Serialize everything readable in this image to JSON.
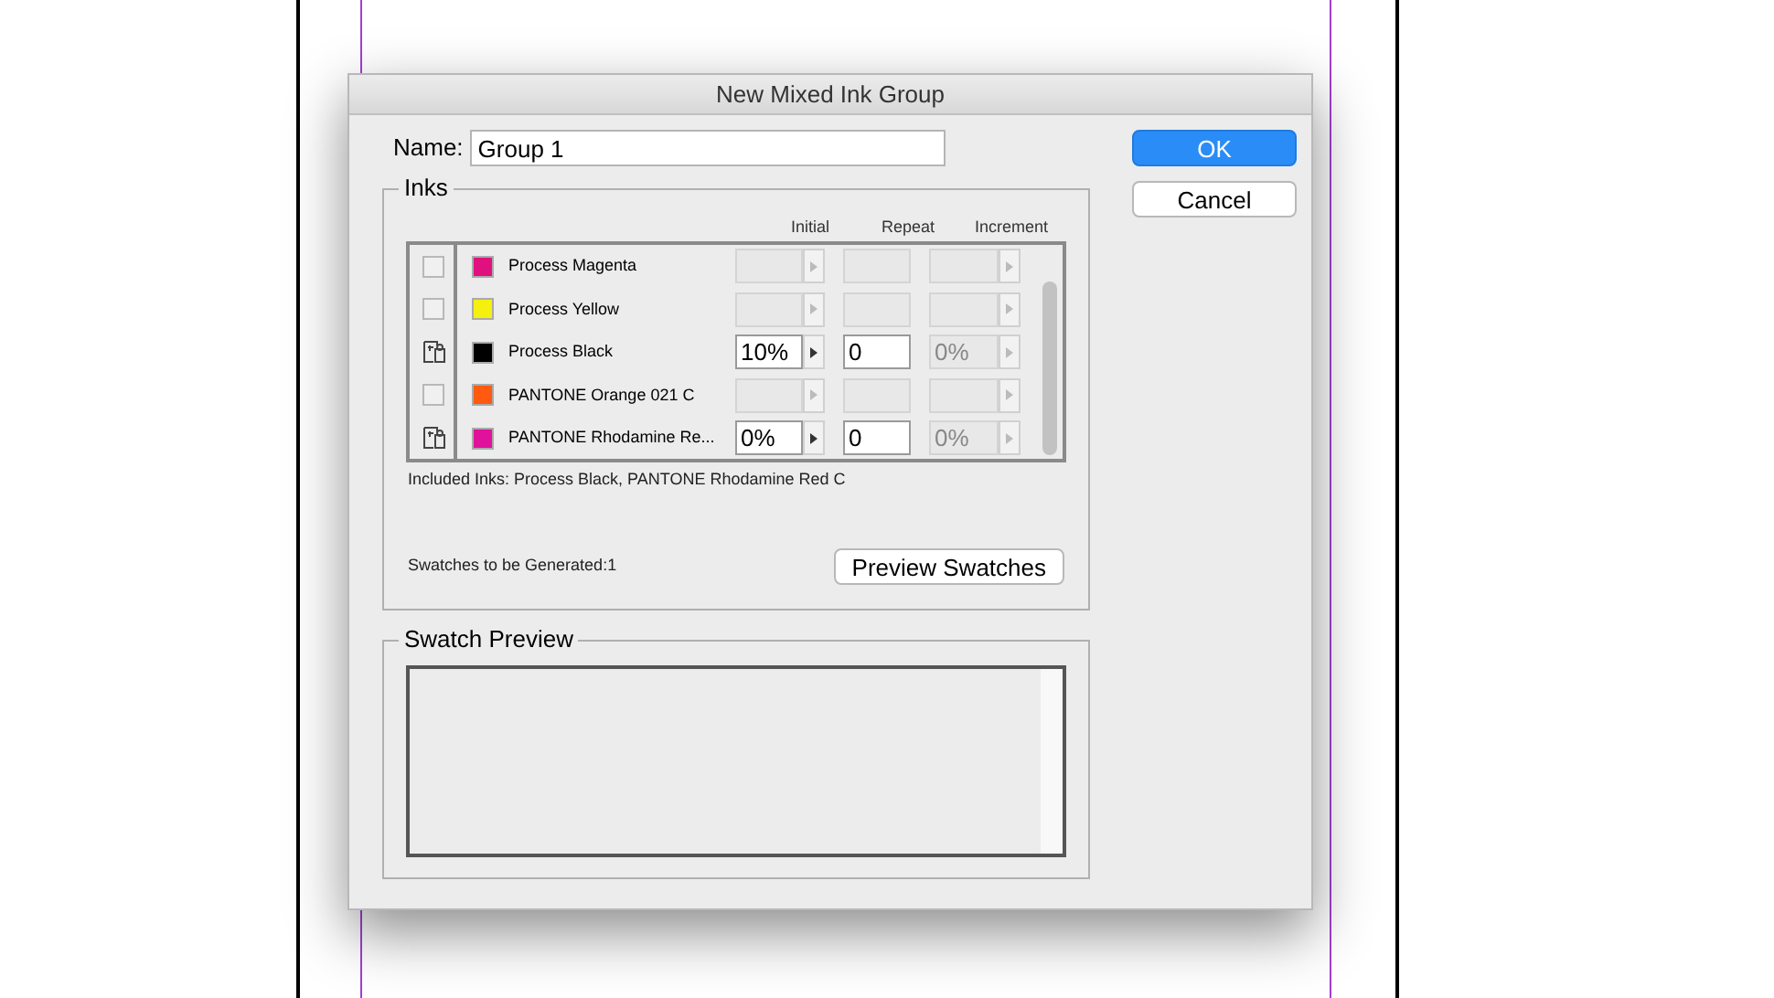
{
  "window": {
    "title": "New Mixed Ink Group"
  },
  "name_field": {
    "label": "Name:",
    "value": "Group 1"
  },
  "buttons": [
    {
      "label": "OK",
      "default": true
    },
    {
      "label": "Cancel",
      "default": false
    }
  ],
  "inks": {
    "title": "Inks",
    "columns": [
      "Initial",
      "Repeat",
      "Increment"
    ],
    "rows": [
      {
        "included": false,
        "color": "#e0117f",
        "name": "Process Magenta"
      },
      {
        "included": false,
        "color": "#f5f00f",
        "name": "Process Yellow"
      },
      {
        "included": true,
        "color": "#000000",
        "name": "Process Black",
        "initial": "10%",
        "repeat": "0",
        "increment": "0%"
      },
      {
        "included": false,
        "color": "#ff5a0f",
        "name": "PANTONE Orange 021 C"
      },
      {
        "included": true,
        "color": "#e0119a",
        "name": "PANTONE Rhodamine Re...",
        "initial": "0%",
        "repeat": "0",
        "increment": "0%"
      }
    ],
    "included_text": "Included Inks: Process Black, PANTONE Rhodamine Red C",
    "generated_text": "Swatches to be Generated:1",
    "preview_button": "Preview Swatches"
  },
  "swatch_preview": {
    "title": "Swatch Preview"
  }
}
